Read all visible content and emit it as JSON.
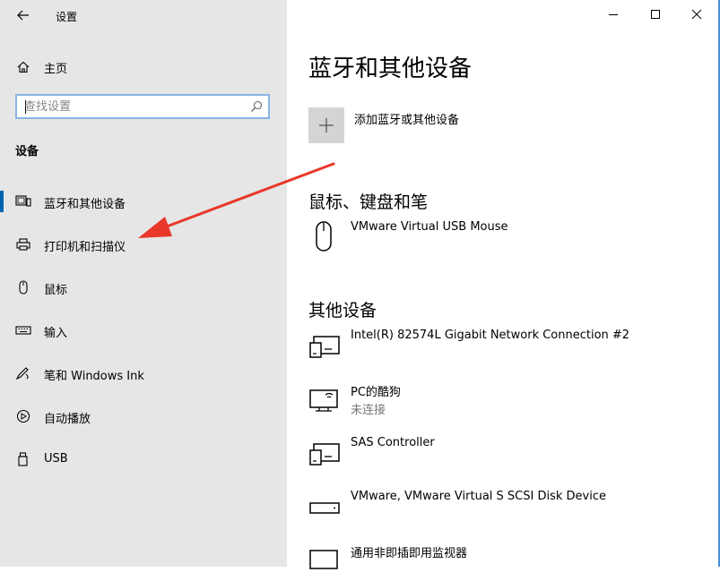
{
  "window": {
    "title": "设置",
    "accent_color": "#0063b1",
    "arrow_color": "#e8382a"
  },
  "sidebar": {
    "home_label": "主页",
    "search_placeholder": "查找设置",
    "section_title": "设备",
    "items": [
      {
        "label": "蓝牙和其他设备",
        "icon": "bluetooth-devices-icon",
        "selected": true
      },
      {
        "label": "打印机和扫描仪",
        "icon": "printer-icon",
        "selected": false
      },
      {
        "label": "鼠标",
        "icon": "mouse-icon",
        "selected": false
      },
      {
        "label": "输入",
        "icon": "keyboard-icon",
        "selected": false
      },
      {
        "label": "笔和 Windows Ink",
        "icon": "pen-icon",
        "selected": false
      },
      {
        "label": "自动播放",
        "icon": "autoplay-icon",
        "selected": false
      },
      {
        "label": "USB",
        "icon": "usb-icon",
        "selected": false
      }
    ]
  },
  "main": {
    "title": "蓝牙和其他设备",
    "add_label": "添加蓝牙或其他设备",
    "groups": [
      {
        "title": "鼠标、键盘和笔",
        "devices": [
          {
            "name": "VMware Virtual USB Mouse",
            "status": "",
            "icon": "mouse-icon"
          }
        ]
      },
      {
        "title": "其他设备",
        "devices": [
          {
            "name": "Intel(R) 82574L Gigabit Network Connection #2",
            "status": "",
            "icon": "network-device-icon"
          },
          {
            "name": "PC的酷狗",
            "status": "未连接",
            "icon": "media-device-icon"
          },
          {
            "name": "SAS Controller",
            "status": "",
            "icon": "generic-device-icon"
          },
          {
            "name": "VMware, VMware Virtual S SCSI Disk Device",
            "status": "",
            "icon": "disk-drive-icon"
          },
          {
            "name": "通用非即插即用监视器",
            "status": "",
            "icon": "monitor-icon"
          }
        ]
      }
    ]
  }
}
